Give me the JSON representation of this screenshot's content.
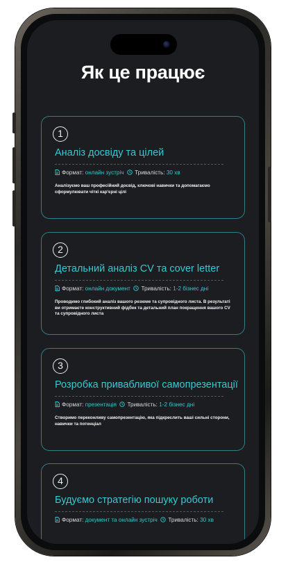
{
  "page": {
    "title": "Як це працює"
  },
  "labels": {
    "format": "Формат:",
    "duration": "Тривалість:"
  },
  "icons": {
    "format": "document-icon",
    "duration": "clock-icon"
  },
  "colors": {
    "accent": "#37c9cf",
    "border": "#2e7f86",
    "background": "#1b1d20"
  },
  "steps": [
    {
      "number": "1",
      "title": "Аналіз досвіду та цілей",
      "format": "онлайн зустріч",
      "duration": "30 хв",
      "description": "Аналізуємо ваш професійний досвід, ключові навички та допомагаємо сформулювати чіткі кар'єрні цілі"
    },
    {
      "number": "2",
      "title": "Детальний аналіз CV та cover letter",
      "format": "онлайн документ",
      "duration": "1-2 бізнес дні",
      "description": "Проводимо глибокий аналіз вашого резюме та супровідного листа. В результаті ви отримаєте конструктивний фідбек та детальний план покращення вашого CV та супровідного листа"
    },
    {
      "number": "3",
      "title": "Розробка привабливої самопрезентації",
      "format": "презентація",
      "duration": "1-2 бізнес дні",
      "description": "Створимо переконливу самопрезентацію, яка підкреслить ваші сильні сторони, навички та потенціал"
    },
    {
      "number": "4",
      "title": "Будуємо стратегію пошуку роботи",
      "format": "документ та онлайн зустріч",
      "duration": "30 хв",
      "description": ""
    }
  ]
}
